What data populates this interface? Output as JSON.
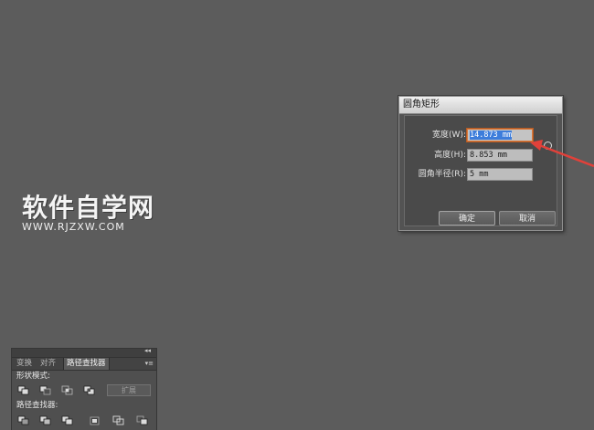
{
  "watermark": {
    "main": "软件自学网",
    "sub": "WWW.RJZXW.COM"
  },
  "dialog": {
    "title": "圆角矩形",
    "fields": [
      {
        "label": "宽度(W):",
        "value": "14.873 mm",
        "selected": true
      },
      {
        "label": "高度(H):",
        "value": "8.853 mm",
        "selected": false
      },
      {
        "label": "圆角半径(R):",
        "value": "5 mm",
        "selected": false
      }
    ],
    "ok_label": "确定",
    "cancel_label": "取消"
  },
  "annotation_color": "#e0413a",
  "panel": {
    "collapse_glyph": "◂◂",
    "tabs": [
      {
        "label": "变换",
        "active": false
      },
      {
        "label": "对齐",
        "active": false
      },
      {
        "label": "路径查找器",
        "active": true
      }
    ],
    "menu_glyph": "▾≡",
    "shape_modes_label": "形状模式:",
    "expand_label": "扩展",
    "pathfinders_label": "路径查找器:",
    "shape_mode_icons": [
      "unite-icon",
      "minus-front-icon",
      "intersect-icon",
      "exclude-icon"
    ],
    "pathfinder_icons": [
      "divide-icon",
      "trim-icon",
      "merge-icon",
      "crop-icon",
      "outline-icon",
      "minus-back-icon"
    ]
  }
}
